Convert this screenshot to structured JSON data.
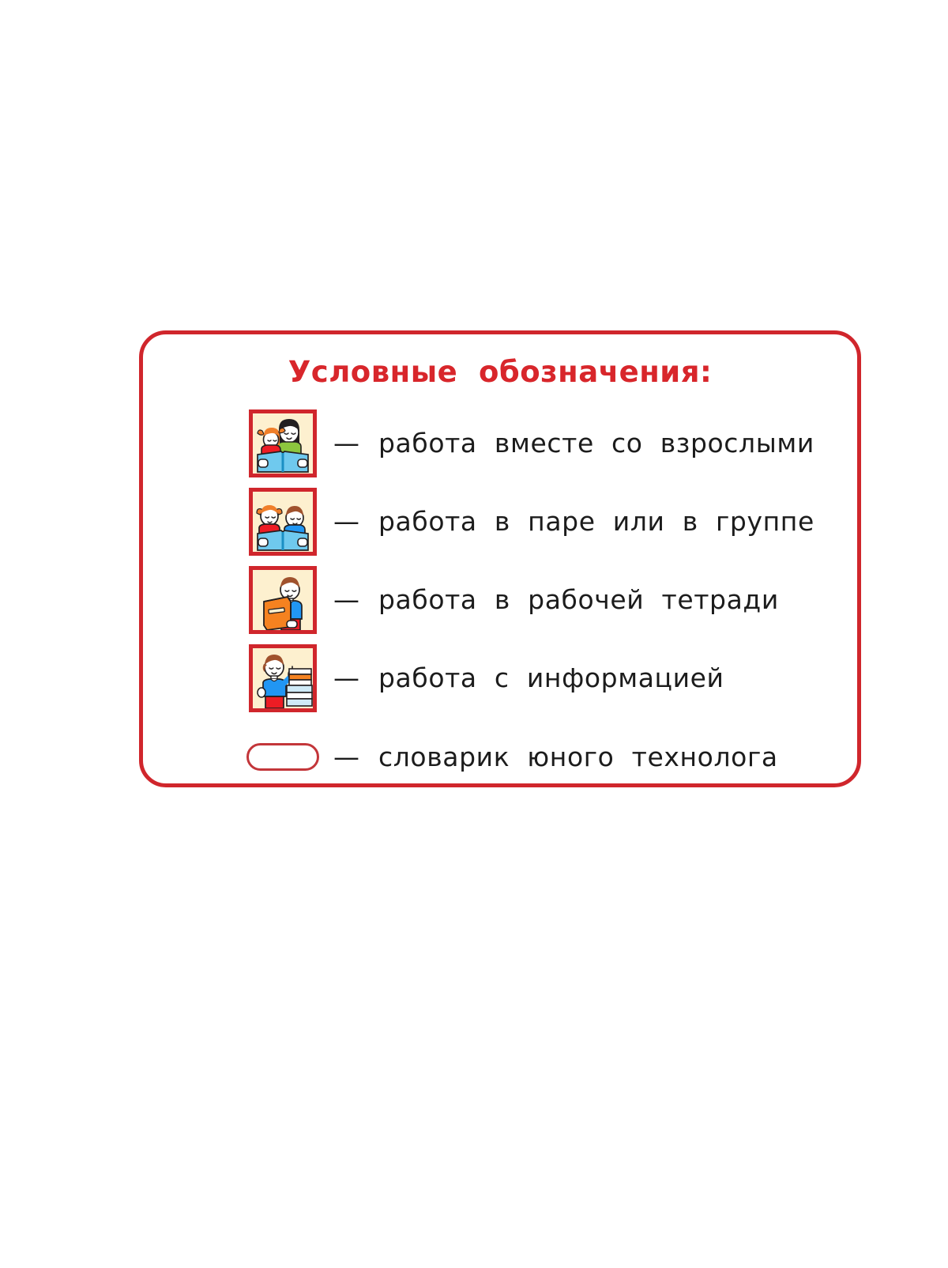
{
  "page": {
    "background": "#ffffff",
    "accent_red": "#d0262c",
    "text_color": "#1c1c1c"
  },
  "legend": {
    "title": "Условные  обозначения:",
    "dash": "—",
    "items": [
      {
        "icon": "adult-and-child-reading-book-icon",
        "label": "работа  вместе  со  взрослыми"
      },
      {
        "icon": "two-children-reading-book-icon",
        "label": "работа  в  паре  или  в  группе"
      },
      {
        "icon": "boy-holding-workbook-icon",
        "label": "работа  в  рабочей  тетради"
      },
      {
        "icon": "boy-with-stack-of-books-icon",
        "label": "работа  с  информацией"
      },
      {
        "icon": "rounded-pill-outline-icon",
        "label": "словарик  юного  технолога"
      }
    ]
  }
}
